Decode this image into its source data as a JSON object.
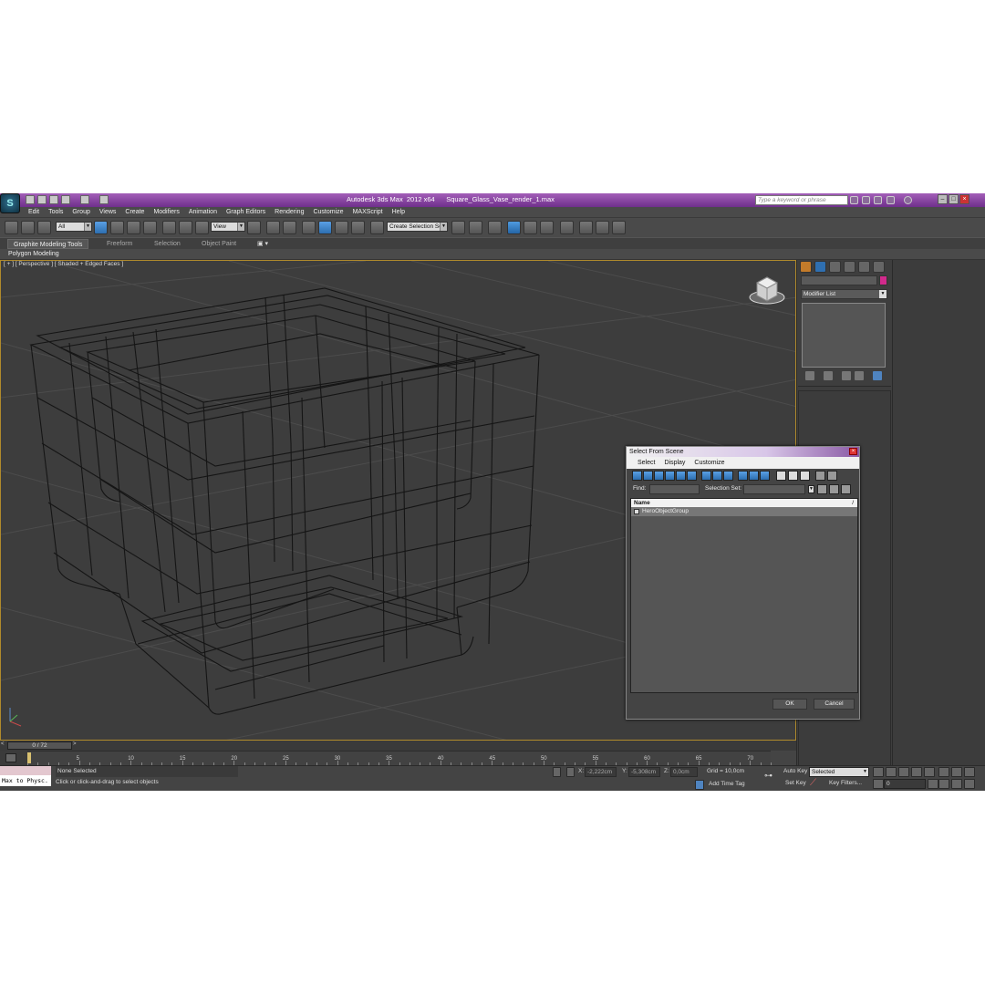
{
  "title_bar": {
    "app_title": "Autodesk 3ds Max  2012 x64      Square_Glass_Vase_render_1.max",
    "search_placeholder": "Type a keyword or phrase"
  },
  "menu": [
    "Edit",
    "Tools",
    "Group",
    "Views",
    "Create",
    "Modifiers",
    "Animation",
    "Graph Editors",
    "Rendering",
    "Customize",
    "MAXScript",
    "Help"
  ],
  "toolbar": {
    "filter_dropdown": "All",
    "ref_coord_dropdown": "View",
    "selection_set_dropdown": "Create Selection Se"
  },
  "ribbon": {
    "tabs": [
      "Graphite Modeling Tools",
      "Freeform",
      "Selection",
      "Object Paint"
    ],
    "active_tab": "Graphite Modeling Tools",
    "panel_label": "Polygon Modeling"
  },
  "viewport": {
    "label": "[ + ] [ Perspective ] [ Shaded + Edged Faces ]"
  },
  "command_panel": {
    "modifier_list": "Modifier List",
    "object_color": "#d12a8c"
  },
  "dialog": {
    "title": "Select From Scene",
    "menu": [
      "Select",
      "Display",
      "Customize"
    ],
    "find_label": "Find:",
    "selection_set_label": "Selection Set:",
    "column_name": "Name",
    "sort_glyph": "/",
    "rows": [
      "HeroObjectGroup"
    ],
    "ok": "OK",
    "cancel": "Cancel"
  },
  "timeline": {
    "slider": "0 / 72",
    "ticks": [
      "5",
      "10",
      "15",
      "20",
      "25",
      "30",
      "35",
      "40",
      "45",
      "50",
      "55",
      "60",
      "65",
      "70"
    ]
  },
  "status": {
    "maxscript": "Max to Physc.",
    "selection": "None Selected",
    "hint": "Click or click-and-drag to select objects",
    "x_label": "X:",
    "x_value": "-2,222cm",
    "y_label": "Y:",
    "y_value": "-5,308cm",
    "z_label": "Z:",
    "z_value": "0,0cm",
    "grid": "Grid = 10,0cm",
    "add_time_tag": "Add Time Tag",
    "auto_key": "Auto Key",
    "set_key": "Set Key",
    "selected_dropdown": "Selected",
    "key_filters": "Key Filters...",
    "frame": "0"
  }
}
